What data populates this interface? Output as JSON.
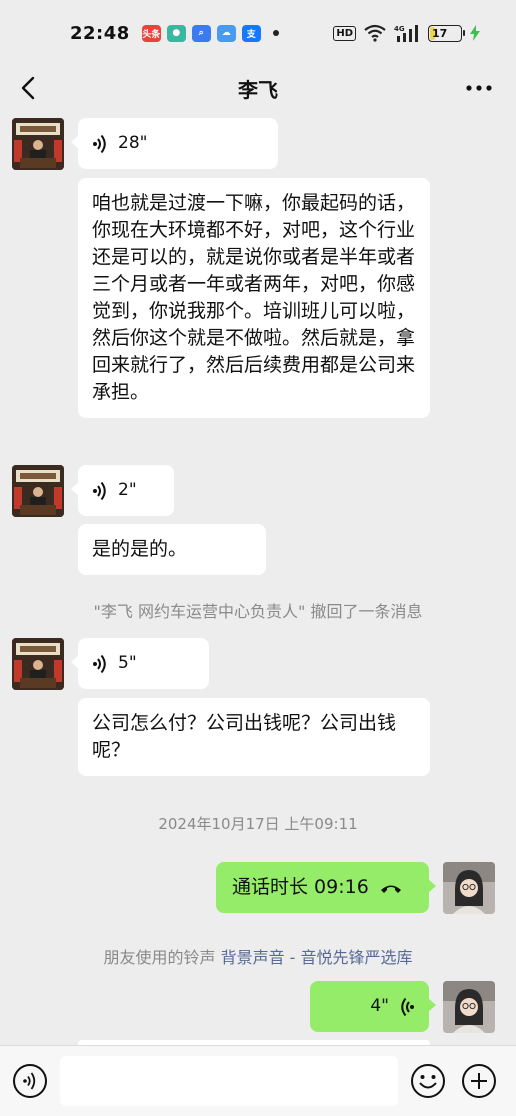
{
  "status_bar": {
    "time": "22:48",
    "apps": [
      {
        "name": "toutiao-app-icon",
        "label": "头条",
        "color": "#e8443b"
      },
      {
        "name": "chat-app-icon",
        "label": "",
        "color": "#3bb6a1"
      },
      {
        "name": "search-app-icon",
        "label": "",
        "color": "#3a7cf0"
      },
      {
        "name": "weather-app-icon",
        "label": "",
        "color": "#4a9bf0"
      },
      {
        "name": "alipay-app-icon",
        "label": "支",
        "color": "#1677ff"
      }
    ],
    "hd_label": "HD",
    "network_label": "4G",
    "battery_level": "17"
  },
  "nav": {
    "title": "李飞"
  },
  "messages": {
    "m1_voice_duration": "28\"",
    "m2_text": "咱也就是过渡一下嘛，你最起码的话，你现在大环境都不好，对吧，这个行业还是可以的，就是说你或者是半年或者三个月或者一年或者两年，对吧，你感觉到，你说我那个。培训班儿可以啦，然后你这个就是不做啦。然后就是，拿回来就行了，然后后续费用都是公司来承担。",
    "m3_voice_duration": "2\"",
    "m4_text": "是的是的。",
    "recall_notice": "\"李飞  网约车运营中心负责人\" 撤回了一条消息",
    "m5_voice_duration": "5\"",
    "m6_text": "公司怎么付？公司出钱呢？公司出钱呢？",
    "timestamp": "2024年10月17日 上午09:11",
    "call_text": "通话时长 09:16",
    "ringtone_prefix": "朋友使用的铃声 ",
    "ringtone_link": "背景声音 - 音悦先锋严选库",
    "m7_voice_duration": "4\""
  },
  "colors": {
    "sent_bubble": "#95ec69",
    "received_bubble": "#ffffff",
    "background": "#ededed",
    "link": "#576b95"
  }
}
